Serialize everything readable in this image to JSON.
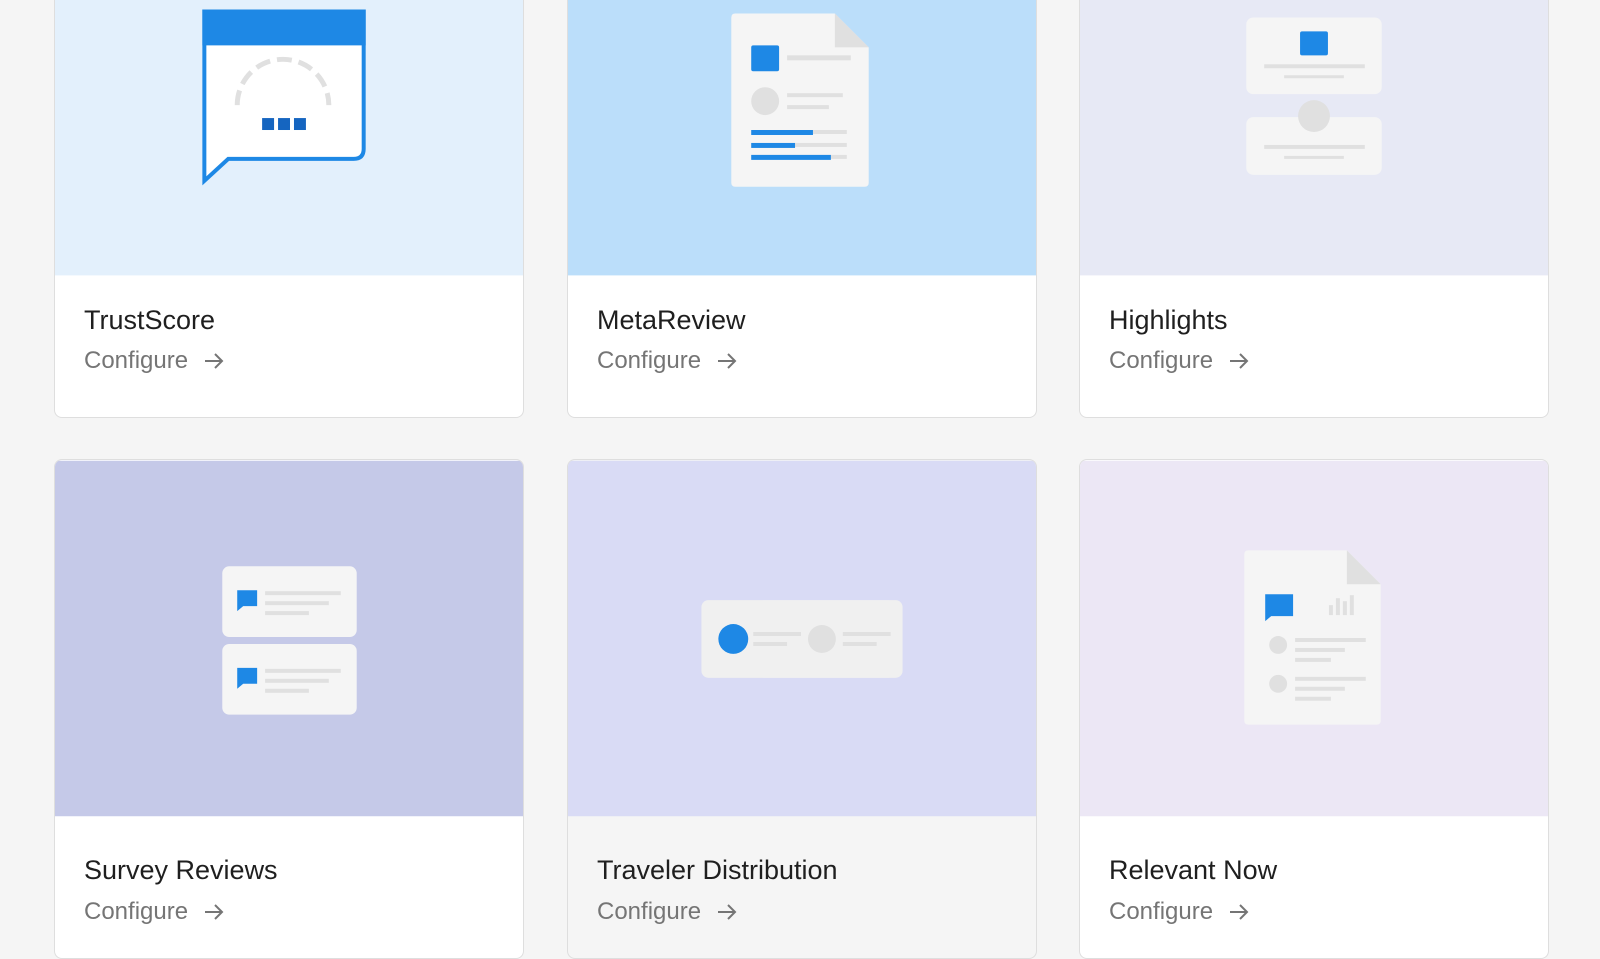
{
  "cards": [
    {
      "title": "TrustScore",
      "action": "Configure",
      "art_color": "#e3f0fc",
      "illustration": "speech-bubble-gauge-icon"
    },
    {
      "title": "MetaReview",
      "action": "Configure",
      "art_color": "#bbdefa",
      "illustration": "document-icon"
    },
    {
      "title": "Highlights",
      "action": "Configure",
      "art_color": "#e7e9f5",
      "illustration": "highlight-cards-icon"
    },
    {
      "title": "Survey Reviews",
      "action": "Configure",
      "art_color": "#c5c9e8",
      "illustration": "review-list-icon"
    },
    {
      "title": "Traveler Distribution",
      "action": "Configure",
      "art_color": "#d9dbf5",
      "illustration": "distribution-toggle-icon"
    },
    {
      "title": "Relevant Now",
      "action": "Configure",
      "art_color": "#ece7f5",
      "illustration": "report-document-icon"
    }
  ],
  "colors": {
    "accent_blue": "#1e88e5",
    "dark_blue": "#1565c0",
    "placeholder_gray": "#e0e0e0"
  }
}
